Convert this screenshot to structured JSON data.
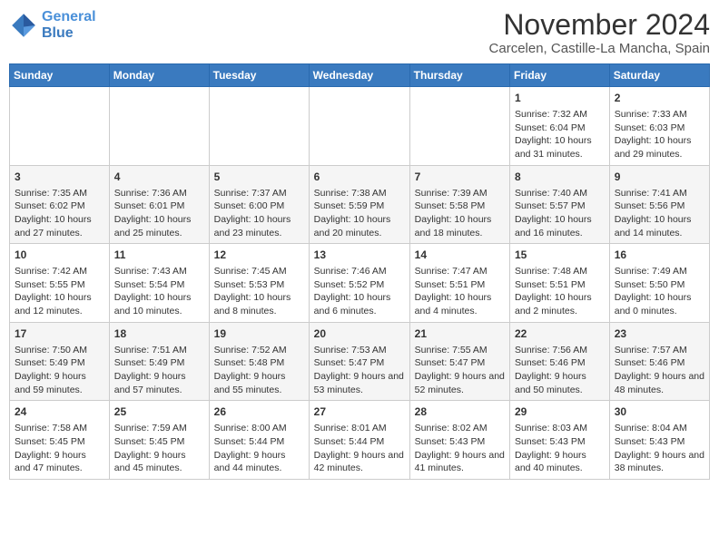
{
  "header": {
    "logo_line1": "General",
    "logo_line2": "Blue",
    "title": "November 2024",
    "subtitle": "Carcelen, Castille-La Mancha, Spain"
  },
  "weekdays": [
    "Sunday",
    "Monday",
    "Tuesday",
    "Wednesday",
    "Thursday",
    "Friday",
    "Saturday"
  ],
  "weeks": [
    [
      {
        "day": "",
        "info": ""
      },
      {
        "day": "",
        "info": ""
      },
      {
        "day": "",
        "info": ""
      },
      {
        "day": "",
        "info": ""
      },
      {
        "day": "",
        "info": ""
      },
      {
        "day": "1",
        "info": "Sunrise: 7:32 AM\nSunset: 6:04 PM\nDaylight: 10 hours and 31 minutes."
      },
      {
        "day": "2",
        "info": "Sunrise: 7:33 AM\nSunset: 6:03 PM\nDaylight: 10 hours and 29 minutes."
      }
    ],
    [
      {
        "day": "3",
        "info": "Sunrise: 7:35 AM\nSunset: 6:02 PM\nDaylight: 10 hours and 27 minutes."
      },
      {
        "day": "4",
        "info": "Sunrise: 7:36 AM\nSunset: 6:01 PM\nDaylight: 10 hours and 25 minutes."
      },
      {
        "day": "5",
        "info": "Sunrise: 7:37 AM\nSunset: 6:00 PM\nDaylight: 10 hours and 23 minutes."
      },
      {
        "day": "6",
        "info": "Sunrise: 7:38 AM\nSunset: 5:59 PM\nDaylight: 10 hours and 20 minutes."
      },
      {
        "day": "7",
        "info": "Sunrise: 7:39 AM\nSunset: 5:58 PM\nDaylight: 10 hours and 18 minutes."
      },
      {
        "day": "8",
        "info": "Sunrise: 7:40 AM\nSunset: 5:57 PM\nDaylight: 10 hours and 16 minutes."
      },
      {
        "day": "9",
        "info": "Sunrise: 7:41 AM\nSunset: 5:56 PM\nDaylight: 10 hours and 14 minutes."
      }
    ],
    [
      {
        "day": "10",
        "info": "Sunrise: 7:42 AM\nSunset: 5:55 PM\nDaylight: 10 hours and 12 minutes."
      },
      {
        "day": "11",
        "info": "Sunrise: 7:43 AM\nSunset: 5:54 PM\nDaylight: 10 hours and 10 minutes."
      },
      {
        "day": "12",
        "info": "Sunrise: 7:45 AM\nSunset: 5:53 PM\nDaylight: 10 hours and 8 minutes."
      },
      {
        "day": "13",
        "info": "Sunrise: 7:46 AM\nSunset: 5:52 PM\nDaylight: 10 hours and 6 minutes."
      },
      {
        "day": "14",
        "info": "Sunrise: 7:47 AM\nSunset: 5:51 PM\nDaylight: 10 hours and 4 minutes."
      },
      {
        "day": "15",
        "info": "Sunrise: 7:48 AM\nSunset: 5:51 PM\nDaylight: 10 hours and 2 minutes."
      },
      {
        "day": "16",
        "info": "Sunrise: 7:49 AM\nSunset: 5:50 PM\nDaylight: 10 hours and 0 minutes."
      }
    ],
    [
      {
        "day": "17",
        "info": "Sunrise: 7:50 AM\nSunset: 5:49 PM\nDaylight: 9 hours and 59 minutes."
      },
      {
        "day": "18",
        "info": "Sunrise: 7:51 AM\nSunset: 5:49 PM\nDaylight: 9 hours and 57 minutes."
      },
      {
        "day": "19",
        "info": "Sunrise: 7:52 AM\nSunset: 5:48 PM\nDaylight: 9 hours and 55 minutes."
      },
      {
        "day": "20",
        "info": "Sunrise: 7:53 AM\nSunset: 5:47 PM\nDaylight: 9 hours and 53 minutes."
      },
      {
        "day": "21",
        "info": "Sunrise: 7:55 AM\nSunset: 5:47 PM\nDaylight: 9 hours and 52 minutes."
      },
      {
        "day": "22",
        "info": "Sunrise: 7:56 AM\nSunset: 5:46 PM\nDaylight: 9 hours and 50 minutes."
      },
      {
        "day": "23",
        "info": "Sunrise: 7:57 AM\nSunset: 5:46 PM\nDaylight: 9 hours and 48 minutes."
      }
    ],
    [
      {
        "day": "24",
        "info": "Sunrise: 7:58 AM\nSunset: 5:45 PM\nDaylight: 9 hours and 47 minutes."
      },
      {
        "day": "25",
        "info": "Sunrise: 7:59 AM\nSunset: 5:45 PM\nDaylight: 9 hours and 45 minutes."
      },
      {
        "day": "26",
        "info": "Sunrise: 8:00 AM\nSunset: 5:44 PM\nDaylight: 9 hours and 44 minutes."
      },
      {
        "day": "27",
        "info": "Sunrise: 8:01 AM\nSunset: 5:44 PM\nDaylight: 9 hours and 42 minutes."
      },
      {
        "day": "28",
        "info": "Sunrise: 8:02 AM\nSunset: 5:43 PM\nDaylight: 9 hours and 41 minutes."
      },
      {
        "day": "29",
        "info": "Sunrise: 8:03 AM\nSunset: 5:43 PM\nDaylight: 9 hours and 40 minutes."
      },
      {
        "day": "30",
        "info": "Sunrise: 8:04 AM\nSunset: 5:43 PM\nDaylight: 9 hours and 38 minutes."
      }
    ]
  ]
}
